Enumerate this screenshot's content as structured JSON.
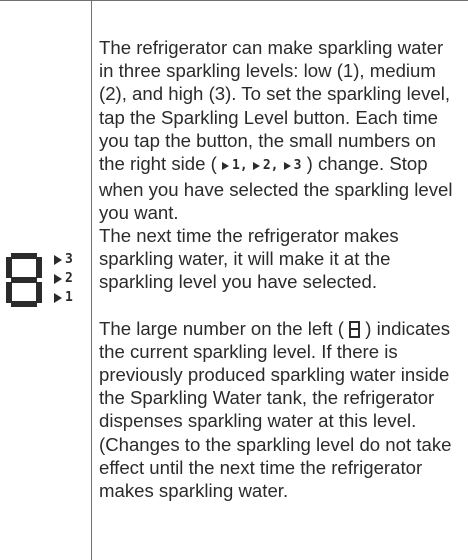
{
  "display": {
    "digit": "8",
    "levels": [
      "3",
      "2",
      "1"
    ]
  },
  "paragraph1": {
    "before": "The refrigerator can make sparkling water in three sparkling levels: low (1), medium (2), and high (3). To set the sparkling level, tap the Sparkling Level button. Each time you tap the button, the small numbers on the right side (",
    "levels": [
      "1,",
      "2,",
      "3"
    ],
    "after": ") change. Stop when you have selected the sparkling level you want."
  },
  "paragraph2": {
    "text": "The next time the refrigerator makes sparkling water, it will make it at the sparkling level you have selected."
  },
  "paragraph3": {
    "before": "The large number on the left (",
    "digit": "8",
    "after": ") indicates the current sparkling level. If there is previously produced sparkling water inside the Sparkling Water tank, the refrigerator dispenses sparkling water at this level. (Changes to the sparkling level do not take effect until the next time the refrigerator makes sparkling water."
  },
  "colors": {
    "text": "#2b2b2b",
    "rule": "#6f6f6f"
  }
}
